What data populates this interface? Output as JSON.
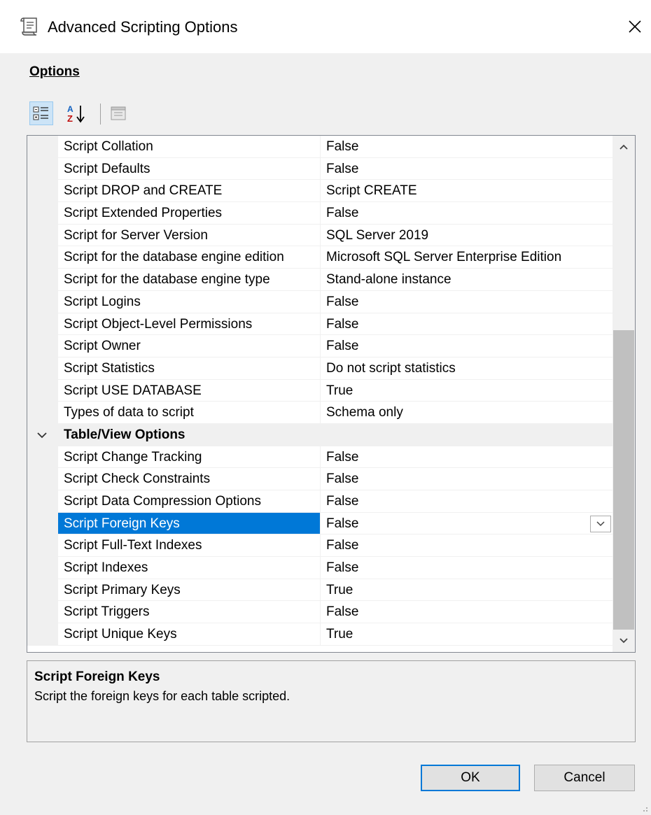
{
  "window": {
    "title": "Advanced Scripting Options",
    "icon": "script-scroll-icon",
    "close_icon": "close-icon"
  },
  "section_label": "Options",
  "toolbar": {
    "buttons": [
      {
        "icon": "categorized-icon",
        "active": true
      },
      {
        "icon": "alphabetical-sort-icon",
        "active": false
      },
      {
        "icon": "property-pages-icon",
        "active": false
      }
    ]
  },
  "property_grid": {
    "rows": [
      {
        "type": "property",
        "name": "Script Collation",
        "value": "False"
      },
      {
        "type": "property",
        "name": "Script Defaults",
        "value": "False"
      },
      {
        "type": "property",
        "name": "Script DROP and CREATE",
        "value": "Script CREATE"
      },
      {
        "type": "property",
        "name": "Script Extended Properties",
        "value": "False"
      },
      {
        "type": "property",
        "name": "Script for Server Version",
        "value": "SQL Server 2019"
      },
      {
        "type": "property",
        "name": "Script for the database engine edition",
        "value": "Microsoft SQL Server Enterprise Edition"
      },
      {
        "type": "property",
        "name": "Script for the database engine type",
        "value": "Stand-alone instance"
      },
      {
        "type": "property",
        "name": "Script Logins",
        "value": "False"
      },
      {
        "type": "property",
        "name": "Script Object-Level Permissions",
        "value": "False"
      },
      {
        "type": "property",
        "name": "Script Owner",
        "value": "False"
      },
      {
        "type": "property",
        "name": "Script Statistics",
        "value": "Do not script statistics"
      },
      {
        "type": "property",
        "name": "Script USE DATABASE",
        "value": "True"
      },
      {
        "type": "property",
        "name": "Types of data to script",
        "value": "Schema only"
      },
      {
        "type": "category",
        "name": "Table/View Options"
      },
      {
        "type": "property",
        "name": "Script Change Tracking",
        "value": "False"
      },
      {
        "type": "property",
        "name": "Script Check Constraints",
        "value": "False"
      },
      {
        "type": "property",
        "name": "Script Data Compression Options",
        "value": "False"
      },
      {
        "type": "property",
        "name": "Script Foreign Keys",
        "value": "False",
        "selected": true
      },
      {
        "type": "property",
        "name": "Script Full-Text Indexes",
        "value": "False"
      },
      {
        "type": "property",
        "name": "Script Indexes",
        "value": "False"
      },
      {
        "type": "property",
        "name": "Script Primary Keys",
        "value": "True"
      },
      {
        "type": "property",
        "name": "Script Triggers",
        "value": "False"
      },
      {
        "type": "property",
        "name": "Script Unique Keys",
        "value": "True"
      }
    ]
  },
  "description": {
    "title": "Script Foreign Keys",
    "text": "Script the foreign keys for each table scripted."
  },
  "buttons": {
    "ok": "OK",
    "cancel": "Cancel"
  },
  "colors": {
    "selection": "#0078d7",
    "background": "#f0f0f0"
  }
}
